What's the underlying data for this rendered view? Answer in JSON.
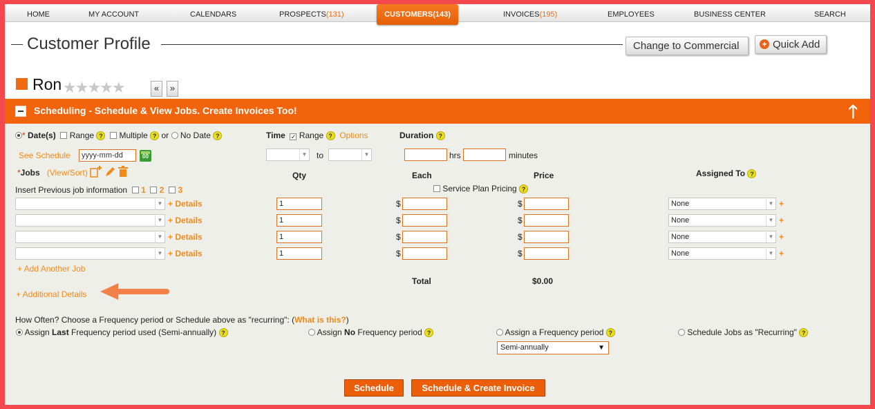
{
  "nav": {
    "home": "HOME",
    "my_account": "MY ACCOUNT",
    "calendars": "CALENDARS",
    "prospects": "PROSPECTS",
    "prospects_count": "(131)",
    "customers": "CUSTOMERS",
    "customers_count": "(143)",
    "invoices": "INVOICES",
    "invoices_count": "(195)",
    "employees": "EMPLOYEES",
    "business_center": "BUSINESS CENTER",
    "search": "SEARCH"
  },
  "header": {
    "title": "Customer Profile",
    "change_button": "Change to Commercial",
    "quick_add_button": "Quick Add",
    "quick_add_symbol": "+"
  },
  "customer": {
    "name": "Ron",
    "stars": "★★★★★",
    "prev": "«",
    "next": "»"
  },
  "section": {
    "title": "Scheduling - Schedule & View Jobs. Create Invoices Too!",
    "up_arrow": "🡑"
  },
  "help_symbol": "?",
  "date": {
    "required": "*",
    "label": "Date(s)",
    "range": "Range",
    "multiple": "Multiple",
    "or": "or",
    "no_date": "No Date",
    "see_schedule": "See Schedule",
    "placeholder": "yyyy-mm-dd",
    "cal_label": "00"
  },
  "time": {
    "label": "Time",
    "range": "Range",
    "options": "Options",
    "to": "to"
  },
  "duration": {
    "label": "Duration",
    "hrs": "hrs",
    "minutes": "minutes"
  },
  "jobs": {
    "required": "*",
    "label": "Jobs",
    "view_sort": "(View/Sort)",
    "insert_prev": "Insert Previous job information",
    "opt1": "1",
    "opt2": "2",
    "opt3": "3",
    "details": "+ Details",
    "add_another": "+ Add Another Job",
    "additional": "+ Additional Details",
    "rows": [
      {
        "qty": "1",
        "assigned": "None"
      },
      {
        "qty": "1",
        "assigned": "None"
      },
      {
        "qty": "1",
        "assigned": "None"
      },
      {
        "qty": "1",
        "assigned": "None"
      }
    ],
    "currency": "$",
    "plus": "+"
  },
  "columns": {
    "qty": "Qty",
    "each": "Each",
    "price": "Price",
    "assigned_to": "Assigned To",
    "service_plan": "Service Plan Pricing"
  },
  "totals": {
    "label": "Total",
    "value": "$0.00"
  },
  "frequency": {
    "question": "How Often? Choose a Frequency period or Schedule above as \"recurring\": (",
    "what_is_this": "What is this?",
    "close_paren": ")",
    "opt_last_pre": "Assign ",
    "opt_last_bold": "Last",
    "opt_last_post": " Frequency period used (Semi-annually)",
    "opt_no_pre": "Assign ",
    "opt_no_bold": "No",
    "opt_no_post": " Frequency period",
    "opt_assign": "Assign a Frequency period",
    "opt_recurring": "Schedule Jobs as \"Recurring\"",
    "select_value": "Semi-annually"
  },
  "actions": {
    "schedule": "Schedule",
    "schedule_invoice": "Schedule & Create Invoice"
  },
  "colors": {
    "accent": "#f2640b",
    "link": "#f08b1a",
    "border_red": "#f4484f"
  }
}
